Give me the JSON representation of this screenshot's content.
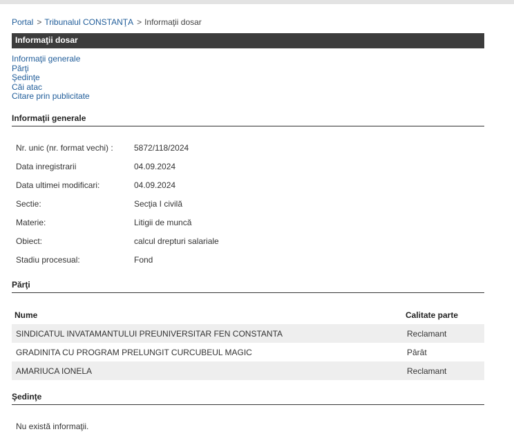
{
  "breadcrumb": {
    "portal": "Portal",
    "sep1": ">",
    "court": "Tribunalul CONSTANŢA",
    "sep2": ">",
    "current": "Informaţii dosar"
  },
  "header": {
    "title": "Informaţii dosar"
  },
  "nav": {
    "items": [
      "Informaţii generale",
      "Părţi",
      "Şedinţe",
      "Căi atac",
      "Citare prin publicitate"
    ]
  },
  "general": {
    "section_title": "Informaţii generale",
    "rows": [
      {
        "label": "Nr. unic (nr. format vechi) :",
        "value": "5872/118/2024"
      },
      {
        "label": "Data inregistrarii",
        "value": "04.09.2024"
      },
      {
        "label": "Data ultimei modificari:",
        "value": "04.09.2024"
      },
      {
        "label": "Sectie:",
        "value": "Secţia I civilă"
      },
      {
        "label": "Materie:",
        "value": "Litigii de muncă"
      },
      {
        "label": "Obiect:",
        "value": "calcul drepturi salariale"
      },
      {
        "label": "Stadiu procesual:",
        "value": "Fond"
      }
    ]
  },
  "parti": {
    "section_title": "Părţi",
    "columns": [
      "Nume",
      "Calitate parte"
    ],
    "rows": [
      {
        "name": "SINDICATUL INVATAMANTULUI PREUNIVERSITAR FEN CONSTANTA",
        "role": "Reclamant"
      },
      {
        "name": "GRADINITA CU PROGRAM PRELUNGIT CURCUBEUL MAGIC",
        "role": "Pârât"
      },
      {
        "name": "AMARIUCA IONELA",
        "role": "Reclamant"
      }
    ]
  },
  "sedinte": {
    "section_title": "Şedinţe",
    "empty_text": "Nu există informaţii."
  }
}
